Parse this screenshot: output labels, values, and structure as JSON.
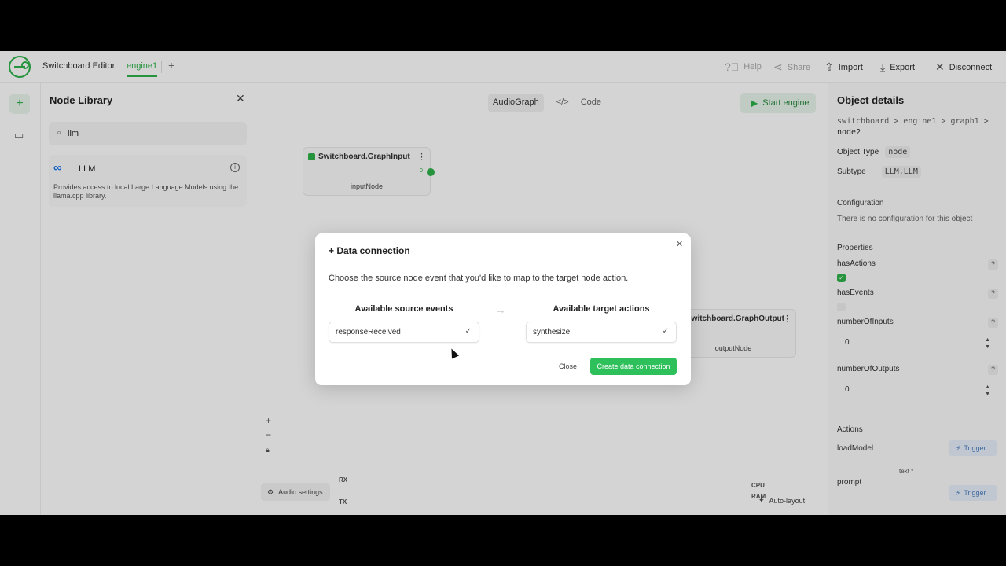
{
  "topbar": {
    "app_name": "Switchboard Editor",
    "tab": "engine1",
    "add_tab": "+",
    "help": "Help",
    "share": "Share",
    "import": "Import",
    "export": "Export",
    "disconnect": "Disconnect"
  },
  "rail": {
    "add": "+",
    "library_icon": "library-icon"
  },
  "library": {
    "title": "Node Library",
    "search_value": "llm",
    "card": {
      "title": "LLM",
      "logo": "meta-logo",
      "description": "Provides access to local Large Language Models using the llama.cpp library."
    }
  },
  "canvas": {
    "view_tabs": [
      "AudioGraph",
      "Code"
    ],
    "active_view": "AudioGraph",
    "start_label": "Start engine",
    "input_node": {
      "title": "Switchboard.GraphInput",
      "port": "0",
      "name": "inputNode"
    },
    "output_node": {
      "title": "Switchboard.GraphOutput",
      "name": "outputNode"
    },
    "zoom_in": "+",
    "zoom_out": "−",
    "auto_layout": "Auto-layout",
    "audio_settings": "Audio settings",
    "rx": "RX",
    "tx": "TX",
    "cpu": "CPU",
    "ram": "RAM"
  },
  "details": {
    "title": "Object details",
    "path": [
      "switchboard",
      "engine1",
      "graph1",
      "node2"
    ],
    "object_type_label": "Object Type",
    "object_type": "node",
    "subtype_label": "Subtype",
    "subtype": "LLM.LLM",
    "configuration_label": "Configuration",
    "configuration_text": "There is no configuration for this object",
    "properties_label": "Properties",
    "has_actions": "hasActions",
    "has_events": "hasEvents",
    "number_of_inputs": "numberOfInputs",
    "number_of_inputs_value": "0",
    "number_of_outputs": "numberOfOutputs",
    "number_of_outputs_value": "0",
    "actions_label": "Actions",
    "load_model": "loadModel",
    "trigger": "Trigger",
    "text_label": "text *",
    "prompt": "prompt"
  },
  "modal": {
    "title": "+ Data connection",
    "description": "Choose the source node event that you'd like to map to the target node action.",
    "source_header": "Available source events",
    "source_value": "responseReceived",
    "target_header": "Available target actions",
    "target_value": "synthesize",
    "close_label": "Close",
    "create_label": "Create data connection"
  },
  "colors": {
    "accent": "#2db34a",
    "create_button": "#2ec05a",
    "trigger_text": "#4a7fc1"
  }
}
